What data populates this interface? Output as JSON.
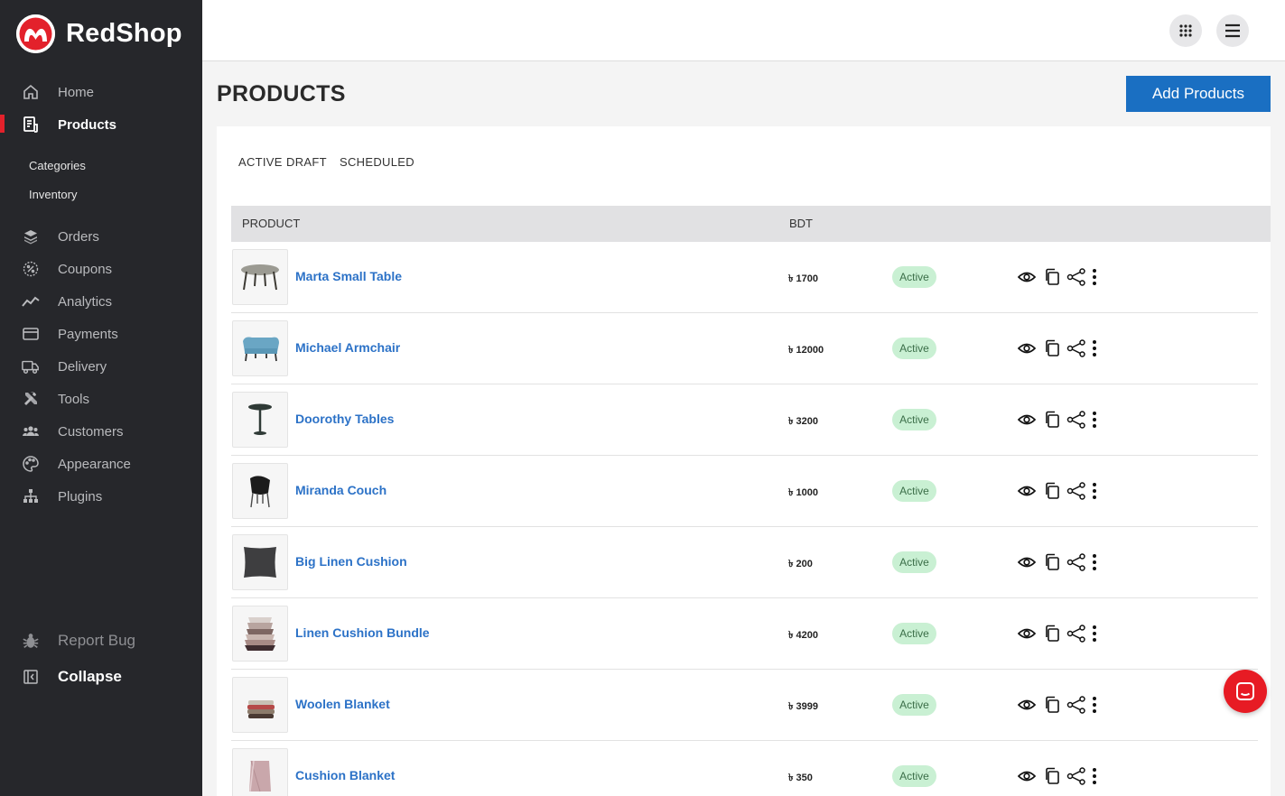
{
  "brand": {
    "name": "RedShop"
  },
  "sidebar": {
    "items": [
      {
        "label": "Home",
        "icon": "home-icon"
      },
      {
        "label": "Products",
        "icon": "products-icon",
        "active": true
      },
      {
        "label": "Orders",
        "icon": "layers-icon"
      },
      {
        "label": "Coupons",
        "icon": "coupon-icon"
      },
      {
        "label": "Analytics",
        "icon": "analytics-icon"
      },
      {
        "label": "Payments",
        "icon": "card-icon"
      },
      {
        "label": "Delivery",
        "icon": "truck-icon"
      },
      {
        "label": "Tools",
        "icon": "tools-icon"
      },
      {
        "label": "Customers",
        "icon": "customers-icon"
      },
      {
        "label": "Appearance",
        "icon": "palette-icon"
      },
      {
        "label": "Plugins",
        "icon": "sitemap-icon"
      }
    ],
    "sub_items": [
      "Categories",
      "Inventory"
    ],
    "report_bug": "Report Bug",
    "collapse": "Collapse"
  },
  "topbar": {
    "apps_icon": "apps-grid-icon",
    "menu_icon": "hamburger-icon"
  },
  "page": {
    "title": "PRODUCTS",
    "add_button": "Add Products"
  },
  "tabs": [
    "ACTIVE",
    "DRAFT",
    "SCHEDULED"
  ],
  "table": {
    "headers": [
      "PRODUCT",
      "BDT"
    ],
    "currency_symbol": "৳",
    "rows": [
      {
        "name": "Marta Small Table",
        "price": "৳ 1700",
        "status": "Active",
        "thumb": "table"
      },
      {
        "name": "Michael Armchair",
        "price": "৳ 12000",
        "status": "Active",
        "thumb": "armchair"
      },
      {
        "name": "Doorothy Tables",
        "price": "৳ 3200",
        "status": "Active",
        "thumb": "round-table"
      },
      {
        "name": "Miranda Couch",
        "price": "৳ 1000",
        "status": "Active",
        "thumb": "chair"
      },
      {
        "name": "Big Linen Cushion",
        "price": "৳ 200",
        "status": "Active",
        "thumb": "cushion"
      },
      {
        "name": "Linen Cushion Bundle",
        "price": "৳ 4200",
        "status": "Active",
        "thumb": "cushion-stack"
      },
      {
        "name": "Woolen Blanket",
        "price": "৳ 3999",
        "status": "Active",
        "thumb": "blanket-stack"
      },
      {
        "name": "Cushion Blanket",
        "price": "৳ 350",
        "status": "Active",
        "thumb": "blanket"
      }
    ]
  },
  "colors": {
    "brand_red": "#e3212b",
    "primary_blue": "#1a6fc2",
    "link_blue": "#2c72c7",
    "badge_green": "#c9f0d3",
    "sidebar_bg": "#26272b"
  }
}
